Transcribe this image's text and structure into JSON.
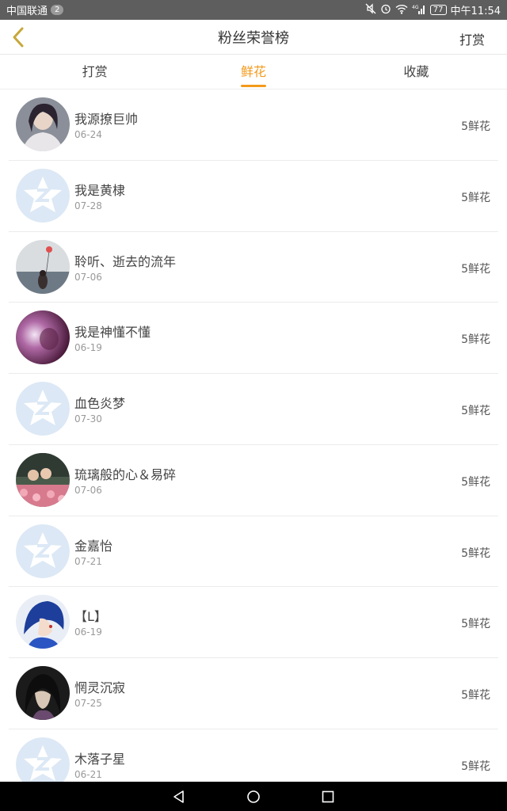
{
  "status_bar": {
    "carrier": "中国联通",
    "notification_count": "2",
    "network": "4G",
    "battery": "77",
    "time": "中午11:54"
  },
  "header": {
    "title": "粉丝荣誉榜",
    "action_label": "打赏"
  },
  "tabs": [
    {
      "label": "打赏",
      "active": false
    },
    {
      "label": "鲜花",
      "active": true
    },
    {
      "label": "收藏",
      "active": false
    }
  ],
  "fans": [
    {
      "name": "我源撩巨帅",
      "date": "06-24",
      "gift": "5鲜花",
      "avatar": "photo-woman-portrait"
    },
    {
      "name": "我是黄棣",
      "date": "07-28",
      "gift": "5鲜花",
      "avatar": "default-star-avatar"
    },
    {
      "name": "聆听、逝去的流年",
      "date": "07-06",
      "gift": "5鲜花",
      "avatar": "photo-girl-balloon-sea"
    },
    {
      "name": "我是神懂不懂",
      "date": "06-19",
      "gift": "5鲜花",
      "avatar": "photo-purple-glow"
    },
    {
      "name": "血色炎梦",
      "date": "07-30",
      "gift": "5鲜花",
      "avatar": "default-star-avatar"
    },
    {
      "name": "琉璃般的心＆易碎",
      "date": "07-06",
      "gift": "5鲜花",
      "avatar": "photo-couple-flowers"
    },
    {
      "name": "金嘉怡",
      "date": "07-21",
      "gift": "5鲜花",
      "avatar": "default-star-avatar"
    },
    {
      "name": "【L】",
      "date": "06-19",
      "gift": "5鲜花",
      "avatar": "anime-blue-hair"
    },
    {
      "name": "惘灵沉寂",
      "date": "07-25",
      "gift": "5鲜花",
      "avatar": "anime-dark-hair"
    },
    {
      "name": "木落子星",
      "date": "06-21",
      "gift": "5鲜花",
      "avatar": "default-star-avatar"
    }
  ],
  "colors": {
    "accent": "#f39a1b",
    "status_bar_bg": "#5e5e5e",
    "system_nav_bg": "#000000"
  }
}
